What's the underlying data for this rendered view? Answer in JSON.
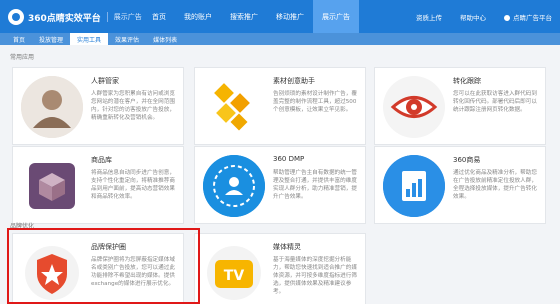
{
  "header": {
    "logo_text": "360点睛实效平台",
    "logo_sub": "展示广告",
    "nav": [
      "首页",
      "我的账户",
      "搜索推广",
      "移动推广",
      "展示广告"
    ],
    "active_nav": 4,
    "right": {
      "upload": "资质上传",
      "help": "帮助中心",
      "user": "点睛广告平台"
    }
  },
  "subnav": {
    "items": [
      "首页",
      "投放管理",
      "实用工具",
      "效果评估",
      "媒体列表"
    ],
    "active": 2
  },
  "sections": {
    "recommended": "常用应用",
    "brand": "品牌优化"
  },
  "cards": [
    {
      "title": "人群管家",
      "desc": "人群管家为您积累自有访问或浏览您网站的潜在客户，并在全网范围内，针对您的访客投放广告投放，精确重新转化及营销机会。",
      "icon": "person-avatar-icon"
    },
    {
      "title": "素材创意助手",
      "desc": "告别烦琐的素材设计制作广告，覆盖完整的制作流程工具，超过500个创意模板，让效果立竿见影。",
      "icon": "puzzle-icon"
    },
    {
      "title": "转化跟踪",
      "desc": "您可以在此获取访客进入群代码到转化回传代码。部署代码后即可以统计跟踪注册网页转化数据。",
      "icon": "eye-icon"
    },
    {
      "title": "商品库",
      "desc": "将商品信息自动同步进广告创意，支持个性化重定向，将精准推荐商品到用户面前，提高动态营销效果和商品转化效率。",
      "icon": "box-icon"
    },
    {
      "title": "360 DMP",
      "desc": "帮助管理广告主自有数据的统一管理及整合打通，并提供丰富的维度实现人群分析，助力精准营销，提升广告效果。",
      "icon": "people-cloud-icon"
    },
    {
      "title": "360商易",
      "desc": "通过优化商品及精准分析，帮助您在广告投放前精准定位投放人群，全程选择投放媒体，提升广告转化效果。",
      "icon": "chart-doc-icon"
    },
    {
      "title": "品牌保护圈",
      "desc": "品牌保护圈将为您屏蔽指定媒体域名或类别广告投放，您可以通过此功能排除不希望出现的媒体。提供exchange的媒体进行展示优化。",
      "icon": "star-shield-icon"
    },
    {
      "title": "媒体精灵",
      "desc": "基于海量媒体的深度挖掘分析能力，帮助您快速找到适合推广的媒体资源，并可按多维度指标进行筛选，提供媒体效果及精准建议参考。",
      "icon": "tv-icon"
    }
  ],
  "colors": {
    "brand_blue": "#1f7bd6",
    "highlight_red": "#e01818"
  }
}
